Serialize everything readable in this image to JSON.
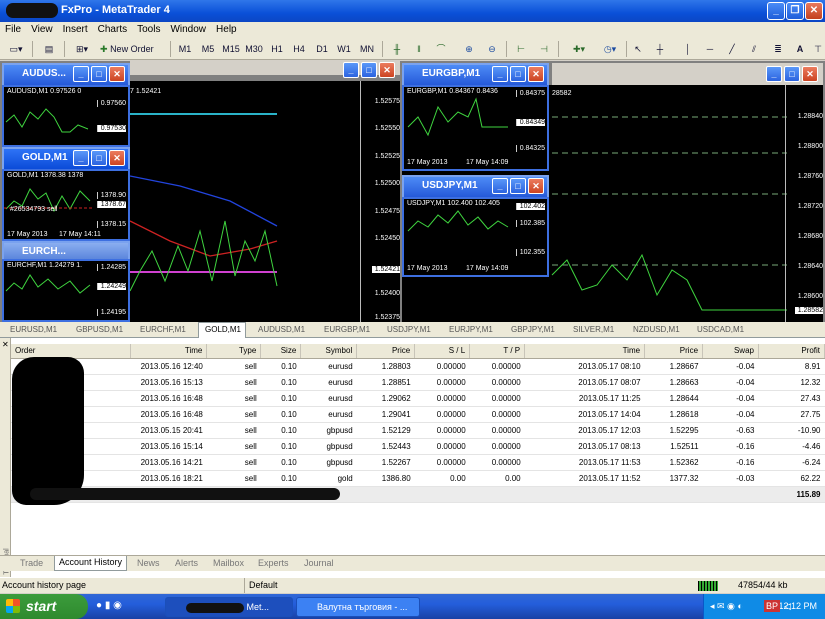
{
  "window": {
    "title": "FxPro - MetaTrader 4"
  },
  "menu": [
    "File",
    "View",
    "Insert",
    "Charts",
    "Tools",
    "Window",
    "Help"
  ],
  "toolbar": {
    "new_order": "New Order",
    "timeframes": [
      "M1",
      "M5",
      "M15",
      "M30",
      "H1",
      "H4",
      "D1",
      "W1",
      "MN"
    ]
  },
  "charts": {
    "audusd_main": {
      "title": "AUDUS...",
      "prices": [
        "1.52575",
        "1.52550",
        "1.52525",
        "1.52500",
        "1.52475",
        "1.52450",
        "1.52421",
        "1.52400",
        "1.52375"
      ],
      "header": "7 1.52421"
    },
    "audusd_mini": {
      "label": "AUDUSD,M1 0.97526 0",
      "prices": [
        "0.97560",
        "0.97530"
      ]
    },
    "gold_mini": {
      "title": "GOLD,M1",
      "label": "GOLD,M1 1378.38 1378",
      "prices": [
        "1378.90",
        "1378.67",
        "1378.15"
      ],
      "order": "#26534793 sell",
      "dates": [
        "17 May 2013",
        "17 May 14:11"
      ]
    },
    "eurchf_mini": {
      "title": "EURCH...",
      "label": "EURCHF,M1 1.24279 1.",
      "prices": [
        "1.24285",
        "1.24249",
        "1.24195"
      ]
    },
    "eurgbp": {
      "title": "EURGBP,M1",
      "label": "EURGBP,M1 0.84367 0.8436",
      "prices": [
        "0.84375",
        "0.84349",
        "0.84325"
      ],
      "dates": [
        "17 May 2013",
        "17 May 14:09"
      ]
    },
    "usdjpy": {
      "title": "USDJPY,M1",
      "label": "USDJPY,M1 102.400 102.405",
      "prices": [
        "102.402",
        "102.385",
        "102.355"
      ],
      "dates": [
        "17 May 2013",
        "17 May 14:09"
      ]
    },
    "right": {
      "header": "28582",
      "prices": [
        "1.28840",
        "1.28800",
        "1.28760",
        "1.28720",
        "1.28680",
        "1.28640",
        "1.28600",
        "1.28582"
      ]
    }
  },
  "symbol_tabs": [
    "EURUSD,M1",
    "GBPUSD,M1",
    "EURCHF,M1",
    "GOLD,M1",
    "AUDUSD,M1",
    "EURGBP,M1",
    "USDJPY,M1",
    "EURJPY,M1",
    "GBPJPY,M1",
    "SILVER,M1",
    "NZDUSD,M1",
    "USDCAD,M1"
  ],
  "active_symbol_tab": "GOLD,M1",
  "history": {
    "columns": [
      "Order",
      "Time",
      "Type",
      "Size",
      "Symbol",
      "Price",
      "S / L",
      "T / P",
      "Time",
      "Price",
      "Swap",
      "Profit"
    ],
    "rows": [
      [
        "",
        "2013.05.16 12:40",
        "sell",
        "0.10",
        "eurusd",
        "1.28803",
        "0.00000",
        "0.00000",
        "2013.05.17 08:10",
        "1.28667",
        "-0.04",
        "8.91"
      ],
      [
        "",
        "2013.05.16 15:13",
        "sell",
        "0.10",
        "eurusd",
        "1.28851",
        "0.00000",
        "0.00000",
        "2013.05.17 08:07",
        "1.28663",
        "-0.04",
        "12.32"
      ],
      [
        "",
        "2013.05.16 16:48",
        "sell",
        "0.10",
        "eurusd",
        "1.29062",
        "0.00000",
        "0.00000",
        "2013.05.17 11:25",
        "1.28644",
        "-0.04",
        "27.43"
      ],
      [
        "",
        "2013.05.16 16:48",
        "sell",
        "0.10",
        "eurusd",
        "1.29041",
        "0.00000",
        "0.00000",
        "2013.05.17 14:04",
        "1.28618",
        "-0.04",
        "27.75"
      ],
      [
        "",
        "2013.05.15 20:41",
        "sell",
        "0.10",
        "gbpusd",
        "1.52129",
        "0.00000",
        "0.00000",
        "2013.05.17 12:03",
        "1.52295",
        "-0.63",
        "-10.90"
      ],
      [
        "",
        "2013.05.16 15:14",
        "sell",
        "0.10",
        "gbpusd",
        "1.52443",
        "0.00000",
        "0.00000",
        "2013.05.17 08:13",
        "1.52511",
        "-0.16",
        "-4.46"
      ],
      [
        "",
        "2013.05.16 14:21",
        "sell",
        "0.10",
        "gbpusd",
        "1.52267",
        "0.00000",
        "0.00000",
        "2013.05.17 11:53",
        "1.52362",
        "-0.16",
        "-6.24"
      ],
      [
        "",
        "2013.05.16 18:21",
        "sell",
        "0.10",
        "gold",
        "1386.80",
        "0.00",
        "0.00",
        "2013.05.17 11:52",
        "1377.32",
        "-0.03",
        "62.22"
      ]
    ],
    "total": "115.89"
  },
  "terminal_label": "Terminal",
  "terminal_tabs": [
    "Trade",
    "Account History",
    "News",
    "Alerts",
    "Mailbox",
    "Experts",
    "Journal"
  ],
  "active_terminal_tab": "Account History",
  "status": {
    "left": "Account history page",
    "profile": "Default",
    "traffic": "47854/44 kb"
  },
  "taskbar": {
    "start": "start",
    "tasks": [
      "Met...",
      "Валутна търговия - ..."
    ],
    "lang": "BP",
    "clock": "12:12 PM"
  }
}
